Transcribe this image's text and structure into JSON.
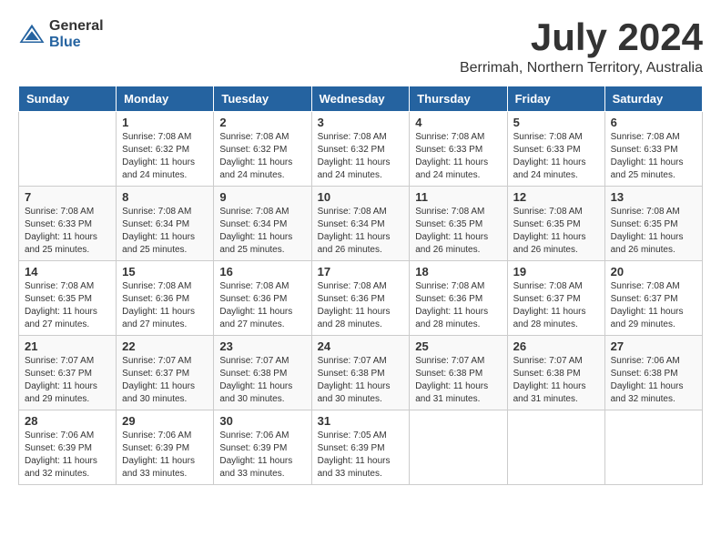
{
  "logo": {
    "general": "General",
    "blue": "Blue"
  },
  "title": {
    "month_year": "July 2024",
    "location": "Berrimah, Northern Territory, Australia"
  },
  "headers": [
    "Sunday",
    "Monday",
    "Tuesday",
    "Wednesday",
    "Thursday",
    "Friday",
    "Saturday"
  ],
  "weeks": [
    [
      {
        "day": "",
        "info": ""
      },
      {
        "day": "1",
        "info": "Sunrise: 7:08 AM\nSunset: 6:32 PM\nDaylight: 11 hours\nand 24 minutes."
      },
      {
        "day": "2",
        "info": "Sunrise: 7:08 AM\nSunset: 6:32 PM\nDaylight: 11 hours\nand 24 minutes."
      },
      {
        "day": "3",
        "info": "Sunrise: 7:08 AM\nSunset: 6:32 PM\nDaylight: 11 hours\nand 24 minutes."
      },
      {
        "day": "4",
        "info": "Sunrise: 7:08 AM\nSunset: 6:33 PM\nDaylight: 11 hours\nand 24 minutes."
      },
      {
        "day": "5",
        "info": "Sunrise: 7:08 AM\nSunset: 6:33 PM\nDaylight: 11 hours\nand 24 minutes."
      },
      {
        "day": "6",
        "info": "Sunrise: 7:08 AM\nSunset: 6:33 PM\nDaylight: 11 hours\nand 25 minutes."
      }
    ],
    [
      {
        "day": "7",
        "info": "Sunrise: 7:08 AM\nSunset: 6:33 PM\nDaylight: 11 hours\nand 25 minutes."
      },
      {
        "day": "8",
        "info": "Sunrise: 7:08 AM\nSunset: 6:34 PM\nDaylight: 11 hours\nand 25 minutes."
      },
      {
        "day": "9",
        "info": "Sunrise: 7:08 AM\nSunset: 6:34 PM\nDaylight: 11 hours\nand 25 minutes."
      },
      {
        "day": "10",
        "info": "Sunrise: 7:08 AM\nSunset: 6:34 PM\nDaylight: 11 hours\nand 26 minutes."
      },
      {
        "day": "11",
        "info": "Sunrise: 7:08 AM\nSunset: 6:35 PM\nDaylight: 11 hours\nand 26 minutes."
      },
      {
        "day": "12",
        "info": "Sunrise: 7:08 AM\nSunset: 6:35 PM\nDaylight: 11 hours\nand 26 minutes."
      },
      {
        "day": "13",
        "info": "Sunrise: 7:08 AM\nSunset: 6:35 PM\nDaylight: 11 hours\nand 26 minutes."
      }
    ],
    [
      {
        "day": "14",
        "info": "Sunrise: 7:08 AM\nSunset: 6:35 PM\nDaylight: 11 hours\nand 27 minutes."
      },
      {
        "day": "15",
        "info": "Sunrise: 7:08 AM\nSunset: 6:36 PM\nDaylight: 11 hours\nand 27 minutes."
      },
      {
        "day": "16",
        "info": "Sunrise: 7:08 AM\nSunset: 6:36 PM\nDaylight: 11 hours\nand 27 minutes."
      },
      {
        "day": "17",
        "info": "Sunrise: 7:08 AM\nSunset: 6:36 PM\nDaylight: 11 hours\nand 28 minutes."
      },
      {
        "day": "18",
        "info": "Sunrise: 7:08 AM\nSunset: 6:36 PM\nDaylight: 11 hours\nand 28 minutes."
      },
      {
        "day": "19",
        "info": "Sunrise: 7:08 AM\nSunset: 6:37 PM\nDaylight: 11 hours\nand 28 minutes."
      },
      {
        "day": "20",
        "info": "Sunrise: 7:08 AM\nSunset: 6:37 PM\nDaylight: 11 hours\nand 29 minutes."
      }
    ],
    [
      {
        "day": "21",
        "info": "Sunrise: 7:07 AM\nSunset: 6:37 PM\nDaylight: 11 hours\nand 29 minutes."
      },
      {
        "day": "22",
        "info": "Sunrise: 7:07 AM\nSunset: 6:37 PM\nDaylight: 11 hours\nand 30 minutes."
      },
      {
        "day": "23",
        "info": "Sunrise: 7:07 AM\nSunset: 6:38 PM\nDaylight: 11 hours\nand 30 minutes."
      },
      {
        "day": "24",
        "info": "Sunrise: 7:07 AM\nSunset: 6:38 PM\nDaylight: 11 hours\nand 30 minutes."
      },
      {
        "day": "25",
        "info": "Sunrise: 7:07 AM\nSunset: 6:38 PM\nDaylight: 11 hours\nand 31 minutes."
      },
      {
        "day": "26",
        "info": "Sunrise: 7:07 AM\nSunset: 6:38 PM\nDaylight: 11 hours\nand 31 minutes."
      },
      {
        "day": "27",
        "info": "Sunrise: 7:06 AM\nSunset: 6:38 PM\nDaylight: 11 hours\nand 32 minutes."
      }
    ],
    [
      {
        "day": "28",
        "info": "Sunrise: 7:06 AM\nSunset: 6:39 PM\nDaylight: 11 hours\nand 32 minutes."
      },
      {
        "day": "29",
        "info": "Sunrise: 7:06 AM\nSunset: 6:39 PM\nDaylight: 11 hours\nand 33 minutes."
      },
      {
        "day": "30",
        "info": "Sunrise: 7:06 AM\nSunset: 6:39 PM\nDaylight: 11 hours\nand 33 minutes."
      },
      {
        "day": "31",
        "info": "Sunrise: 7:05 AM\nSunset: 6:39 PM\nDaylight: 11 hours\nand 33 minutes."
      },
      {
        "day": "",
        "info": ""
      },
      {
        "day": "",
        "info": ""
      },
      {
        "day": "",
        "info": ""
      }
    ]
  ]
}
